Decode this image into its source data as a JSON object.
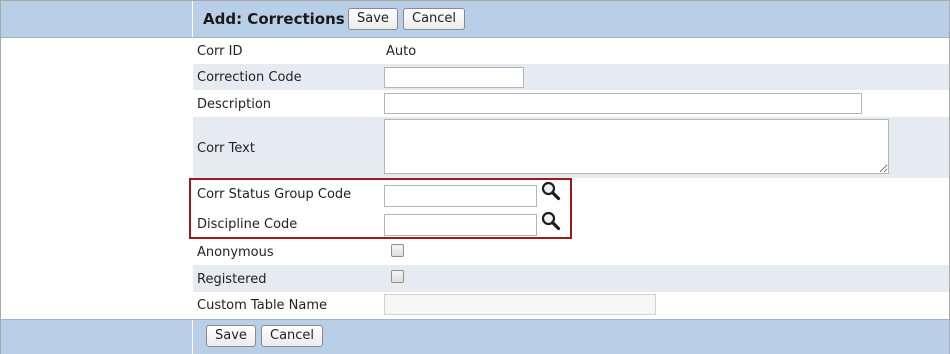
{
  "header": {
    "title": "Add: Corrections",
    "save_label": "Save",
    "cancel_label": "Cancel"
  },
  "footer": {
    "save_label": "Save",
    "cancel_label": "Cancel"
  },
  "fields": {
    "corr_id": {
      "label": "Corr ID",
      "value": "Auto"
    },
    "correction_code": {
      "label": "Correction Code",
      "value": ""
    },
    "description": {
      "label": "Description",
      "value": ""
    },
    "corr_text": {
      "label": "Corr Text",
      "value": ""
    },
    "corr_status_group_code": {
      "label": "Corr Status Group Code",
      "value": "",
      "lookup_icon": "search-icon"
    },
    "discipline_code": {
      "label": "Discipline Code",
      "value": "",
      "lookup_icon": "search-icon"
    },
    "anonymous": {
      "label": "Anonymous",
      "checked": false
    },
    "registered": {
      "label": "Registered",
      "checked": false
    },
    "custom_table_name": {
      "label": "Custom Table Name",
      "value": "",
      "disabled": true
    }
  },
  "colors": {
    "header_bar": "#b9cfe8",
    "alt_row": "#e6ebf1",
    "highlight_border": "#9b1b1b"
  }
}
